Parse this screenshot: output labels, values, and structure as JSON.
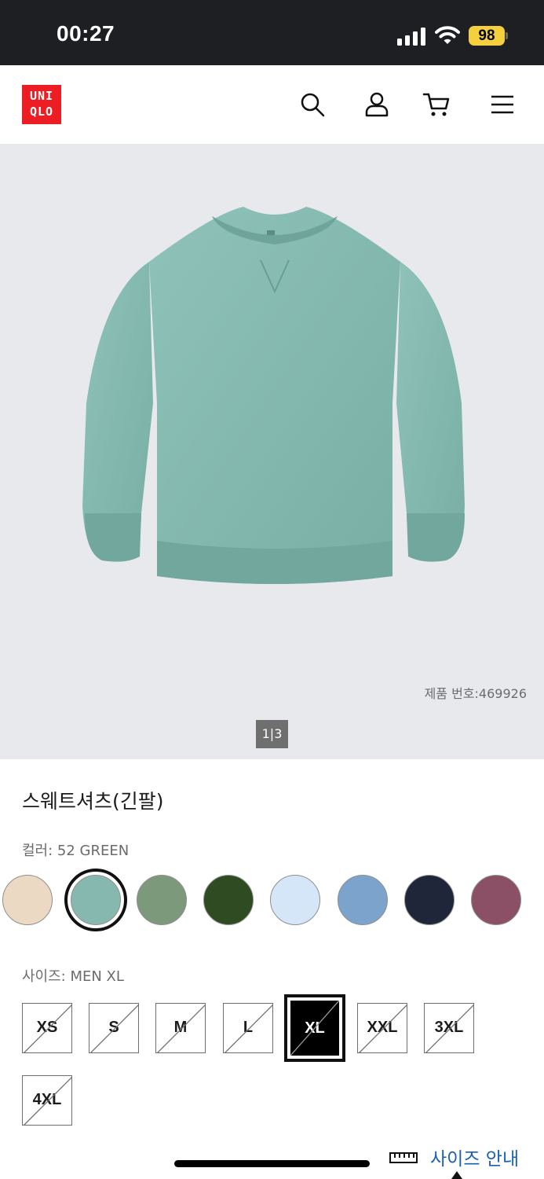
{
  "status_bar": {
    "time": "00:27",
    "battery": "98"
  },
  "header": {
    "logo_top": "UNI",
    "logo_bottom": "QLO",
    "icons": [
      "search-icon",
      "user-icon",
      "cart-icon",
      "menu-icon"
    ]
  },
  "product": {
    "product_number": "제품 번호:469926",
    "image_counter": {
      "current": "1",
      "total": "3"
    },
    "title": "스웨트셔츠(긴팔)"
  },
  "color": {
    "label": "컬러: 52 GREEN",
    "swatches": [
      {
        "name": "beige",
        "hex": "#ecd9c3"
      },
      {
        "name": "green",
        "hex": "#86b8b0",
        "selected": true
      },
      {
        "name": "olive",
        "hex": "#7c9a7b"
      },
      {
        "name": "dark-green",
        "hex": "#2f4b22"
      },
      {
        "name": "light-blue",
        "hex": "#d4e6f7"
      },
      {
        "name": "blue",
        "hex": "#7ba3cc"
      },
      {
        "name": "navy",
        "hex": "#1f2639"
      },
      {
        "name": "purple",
        "hex": "#8b4f66"
      }
    ]
  },
  "size": {
    "label": "사이즈: MEN XL",
    "options": [
      {
        "label": "XS",
        "available": false
      },
      {
        "label": "S",
        "available": false
      },
      {
        "label": "M",
        "available": false
      },
      {
        "label": "L",
        "available": false
      },
      {
        "label": "XL",
        "available": false,
        "selected": true
      },
      {
        "label": "XXL",
        "available": false
      },
      {
        "label": "3XL",
        "available": false
      },
      {
        "label": "4XL",
        "available": false
      }
    ],
    "guide_label": "사이즈 안내"
  },
  "colors": {
    "brand_red": "#ed1d24",
    "link_blue": "#1a5fb4",
    "battery_yellow": "#f4d03f"
  }
}
